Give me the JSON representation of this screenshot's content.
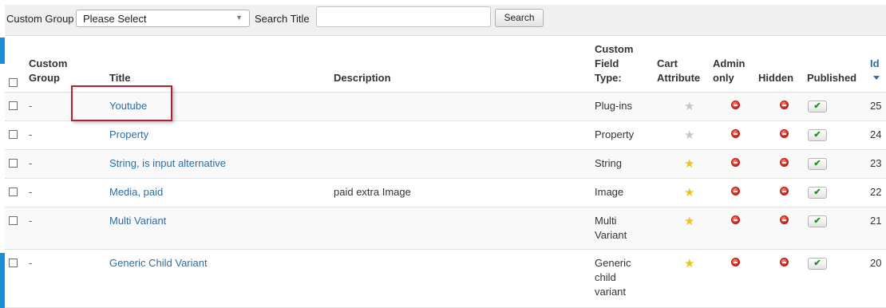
{
  "filter": {
    "custom_group_label": "Custom Group",
    "custom_group_value": "Please Select",
    "search_title_label": "Search Title",
    "search_value": "",
    "search_button": "Search"
  },
  "columns": {
    "custom_group": "Custom Group",
    "title": "Title",
    "description": "Description",
    "field_type": "Custom Field Type:",
    "cart_attribute": "Cart Attribute",
    "admin_only": "Admin only",
    "hidden": "Hidden",
    "published": "Published",
    "id": "Id"
  },
  "rows": [
    {
      "group": "-",
      "title": "Youtube",
      "description": "",
      "type": "Plug-ins",
      "cart_attribute": false,
      "admin_only": "disabled",
      "hidden": "disabled",
      "published": true,
      "id": "25"
    },
    {
      "group": "-",
      "title": "Property",
      "description": "",
      "type": "Property",
      "cart_attribute": false,
      "admin_only": "disabled",
      "hidden": "disabled",
      "published": true,
      "id": "24"
    },
    {
      "group": "-",
      "title": "String, is input alternative",
      "description": "",
      "type": "String",
      "cart_attribute": true,
      "admin_only": "disabled",
      "hidden": "disabled",
      "published": true,
      "id": "23"
    },
    {
      "group": "-",
      "title": "Media, paid",
      "description": "paid extra Image",
      "type": "Image",
      "cart_attribute": true,
      "admin_only": "disabled",
      "hidden": "disabled",
      "published": true,
      "id": "22"
    },
    {
      "group": "-",
      "title": "Multi Variant",
      "description": "",
      "type": "Multi Variant",
      "cart_attribute": true,
      "admin_only": "disabled",
      "hidden": "disabled",
      "published": true,
      "id": "21"
    },
    {
      "group": "-",
      "title": "Generic Child Variant",
      "description": "",
      "type": "Generic child variant",
      "cart_attribute": true,
      "admin_only": "disabled",
      "hidden": "disabled",
      "published": true,
      "id": "20"
    }
  ],
  "icons": {
    "published_check": "✔",
    "star": "★"
  },
  "colors": {
    "accent": "#1a8fd6",
    "link": "#2e6da4",
    "star_active": "#f2c21b",
    "star_inactive": "#c6c6c6",
    "unpublish_red": "#d0221a",
    "highlight": "#b7202a"
  }
}
